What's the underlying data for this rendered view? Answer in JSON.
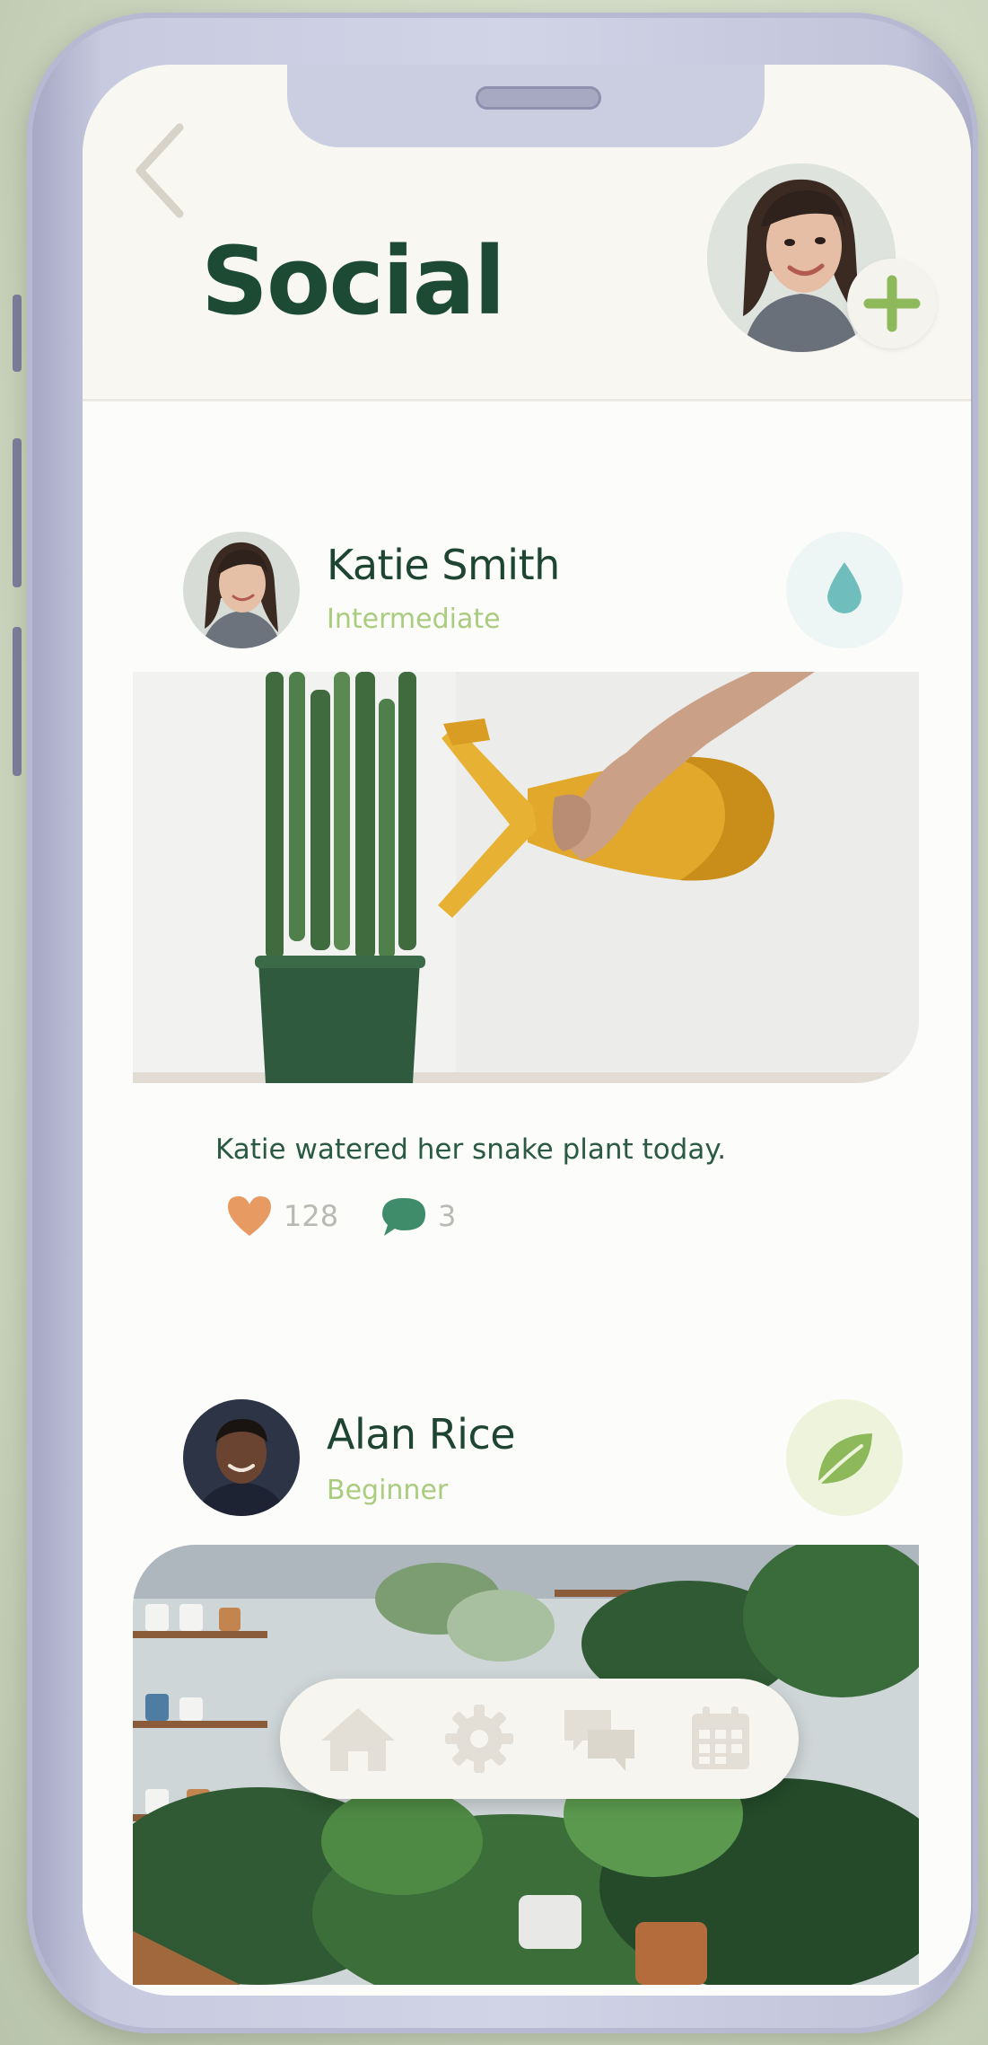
{
  "header": {
    "title": "Social"
  },
  "posts": [
    {
      "name": "Katie Smith",
      "level": "Intermediate",
      "badge_icon": "water-drop-icon",
      "caption": "Katie watered her snake plant today.",
      "likes": "128",
      "comments": "3"
    },
    {
      "name": "Alan Rice",
      "level": "Beginner",
      "badge_icon": "leaf-icon"
    }
  ],
  "nav": {
    "items": [
      "home-icon",
      "gear-icon",
      "chat-icon",
      "calendar-icon"
    ]
  },
  "colors": {
    "title": "#1c4a33",
    "level": "#a9cc7f",
    "heart": "#e79a62",
    "comment": "#3e8c6a",
    "drop": "#6fbdbc",
    "leaf": "#8eb95b",
    "nav_icon": "#e3dfd6"
  }
}
